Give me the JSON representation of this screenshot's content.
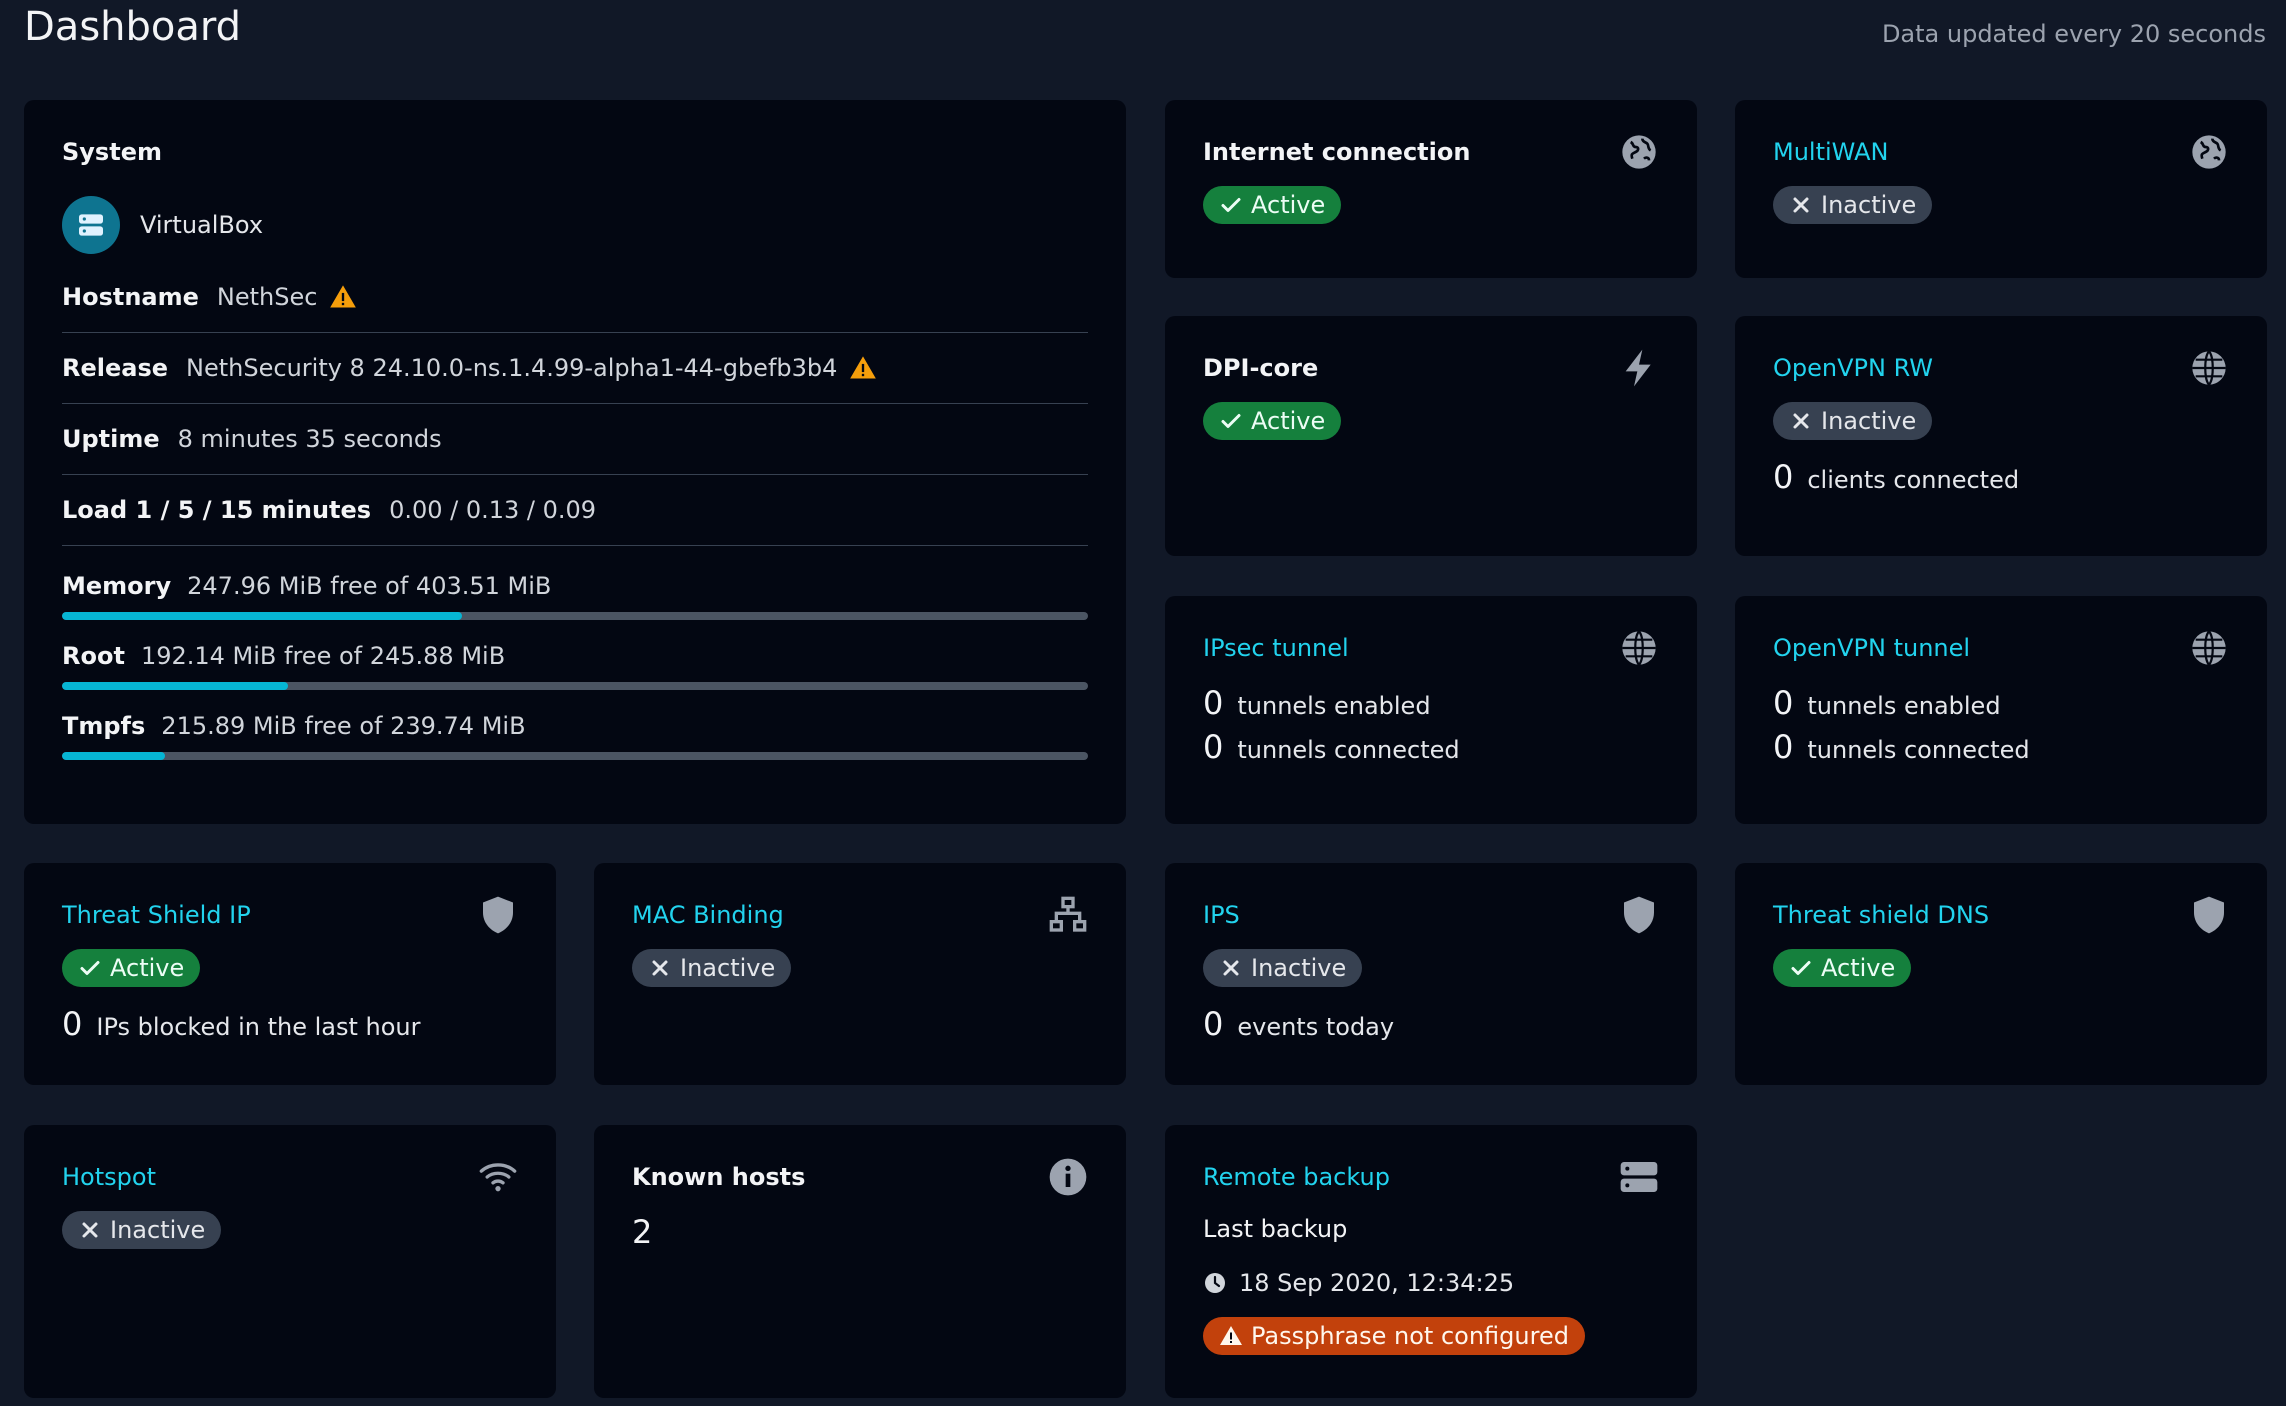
{
  "header": {
    "title": "Dashboard",
    "update_note": "Data updated every 20 seconds"
  },
  "system": {
    "title": "System",
    "device": "VirtualBox",
    "rows": [
      {
        "key": "Hostname",
        "value": "NethSec",
        "warning": true
      },
      {
        "key": "Release",
        "value": "NethSecurity 8 24.10.0-ns.1.4.99-alpha1-44-gbefb3b4",
        "warning": true
      },
      {
        "key": "Uptime",
        "value": "8 minutes 35 seconds",
        "warning": false
      },
      {
        "key": "Load 1 / 5 / 15 minutes",
        "value": "0.00 / 0.13 / 0.09",
        "warning": false
      }
    ],
    "usage": [
      {
        "key": "Memory",
        "value": "247.96 MiB free of 403.51 MiB",
        "used_fraction": 0.39
      },
      {
        "key": "Root",
        "value": "192.14 MiB free of 245.88 MiB",
        "used_fraction": 0.22
      },
      {
        "key": "Tmpfs",
        "value": "215.89 MiB free of 239.74 MiB",
        "used_fraction": 0.1
      }
    ]
  },
  "internet": {
    "title": "Internet connection",
    "status": "Active",
    "icon": "globe-icon"
  },
  "multiwan": {
    "title": "MultiWAN",
    "status": "Inactive",
    "icon": "globe-icon"
  },
  "dpi": {
    "title": "DPI-core",
    "status": "Active",
    "icon": "bolt-icon"
  },
  "openvpn_rw": {
    "title": "OpenVPN RW",
    "status": "Inactive",
    "count": "0",
    "count_label": "clients connected",
    "icon": "network-globe-icon"
  },
  "ipsec": {
    "title": "IPsec tunnel",
    "enabled": "0",
    "enabled_label": "tunnels enabled",
    "connected": "0",
    "connected_label": "tunnels connected",
    "icon": "network-globe-icon"
  },
  "openvpn_tunnel": {
    "title": "OpenVPN tunnel",
    "enabled": "0",
    "enabled_label": "tunnels enabled",
    "connected": "0",
    "connected_label": "tunnels connected",
    "icon": "network-globe-icon"
  },
  "threat_ip": {
    "title": "Threat Shield IP",
    "status": "Active",
    "count": "0",
    "count_label": "IPs blocked in the last hour",
    "icon": "shield-icon"
  },
  "mac_binding": {
    "title": "MAC Binding",
    "status": "Inactive",
    "icon": "network-tree-icon"
  },
  "ips": {
    "title": "IPS",
    "status": "Inactive",
    "count": "0",
    "count_label": "events today",
    "icon": "shield-icon"
  },
  "threat_dns": {
    "title": "Threat shield DNS",
    "status": "Active",
    "icon": "shield-icon"
  },
  "hotspot": {
    "title": "Hotspot",
    "status": "Inactive",
    "icon": "wifi-icon"
  },
  "known_hosts": {
    "title": "Known hosts",
    "count": "2",
    "icon": "info-icon"
  },
  "remote_backup": {
    "title": "Remote backup",
    "last_backup_label": "Last backup",
    "last_backup_time": "18 Sep 2020, 12:34:25",
    "warning": "Passphrase not configured",
    "icon": "server-icon"
  },
  "colors": {
    "background": "#111827",
    "card": "#030712",
    "accent": "#22d3ee",
    "active": "#15803d",
    "inactive": "#374151",
    "warning": "#c2410c"
  }
}
